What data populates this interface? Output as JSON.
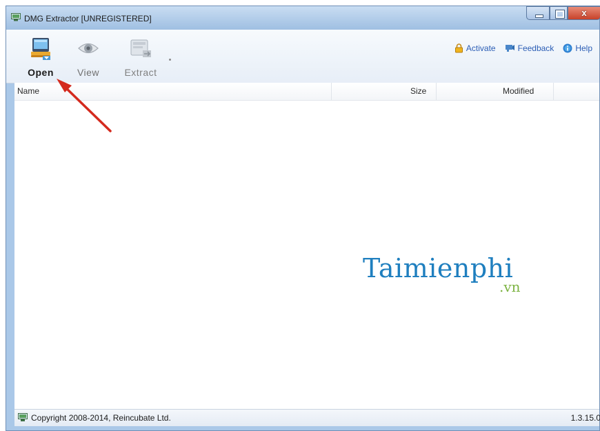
{
  "window": {
    "title": "DMG Extractor [UNREGISTERED]",
    "close_glyph": "x"
  },
  "toolbar": {
    "open_label": "Open",
    "view_label": "View",
    "extract_label": "Extract"
  },
  "links": {
    "activate": "Activate",
    "feedback": "Feedback",
    "help": "Help"
  },
  "columns": {
    "name": "Name",
    "size": "Size",
    "modified": "Modified"
  },
  "watermark": {
    "main": "Taimienphi",
    "sub": ".vn"
  },
  "status": {
    "copyright": "Copyright 2008-2014, Reincubate Ltd.",
    "version": "1.3.15.0"
  },
  "colors": {
    "accent_link": "#2b5db5",
    "annotation_arrow": "#d42a1e",
    "watermark_blue": "#1f7fbf",
    "watermark_green": "#7cb342"
  }
}
